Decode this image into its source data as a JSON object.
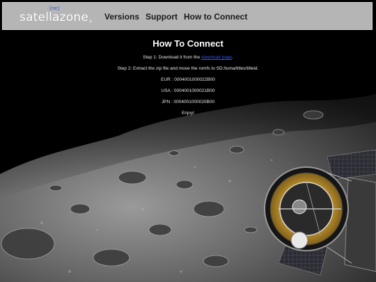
{
  "header": {
    "logo_tag": "[ne]",
    "logo_text": "satellazone",
    "logo_mark": "®",
    "nav": {
      "versions": "Versions",
      "support": "Support",
      "how_to_connect": "How to Connect"
    }
  },
  "main": {
    "title": "How To Connect",
    "step1_prefix": "Step 1: Download it from the ",
    "step1_link": "download page",
    "step1_suffix": ".",
    "step2": "Step 2: Extract the zip file and move the romfs to SD:/luma/titles/titleid.",
    "eur": "EUR : 0004001000022B00",
    "usa": "USA : 0004001000021B00",
    "jpn": "JPN : 0004001000020B00",
    "enjoy": "Enjoy!"
  },
  "colors": {
    "header_bg": "#b5b5b5",
    "background": "#000000",
    "link": "#3355ff",
    "logo_tag": "#2b55c8"
  }
}
